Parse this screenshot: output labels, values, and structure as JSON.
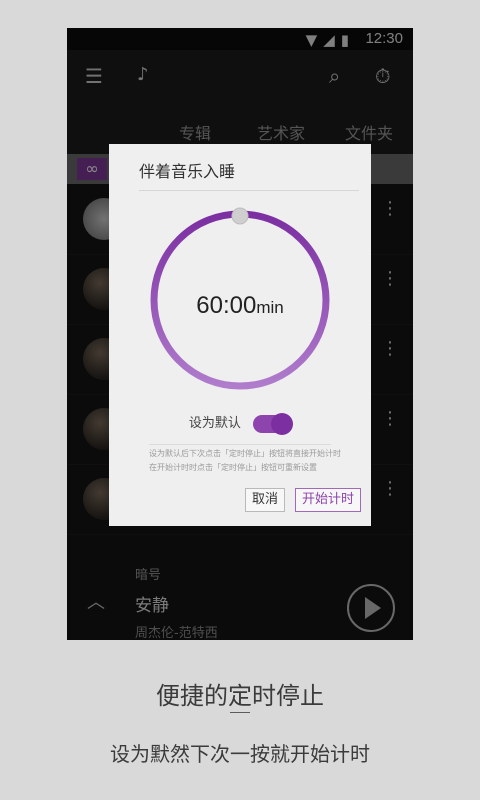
{
  "status_bar": {
    "time": "12:30"
  },
  "app_bar": {
    "icons": [
      "menu-icon",
      "music-note-icon",
      "search-icon",
      "timer-icon"
    ]
  },
  "tabs": [
    "专辑",
    "艺术家",
    "文件夹"
  ],
  "now_playing": {
    "album": "暗号",
    "title": "安静",
    "artist": "周杰伦-范特西"
  },
  "dialog": {
    "title": "伴着音乐入睡",
    "timer_value": "60:00",
    "timer_unit": "min",
    "toggle_label": "设为默认",
    "toggle_on": true,
    "note_line1": "设为默认后下次点击「定时停止」按钮将直接开始计时",
    "note_line2": "在开始计时时点击「定时停止」按钮可重新设置",
    "cancel_label": "取消",
    "start_label": "开始计时",
    "ring_progress": 1.0,
    "accent_color": "#8e44ad"
  },
  "captions": {
    "headline": "便捷的定时停止",
    "subline": "设为默然下次一按就开始计时"
  }
}
